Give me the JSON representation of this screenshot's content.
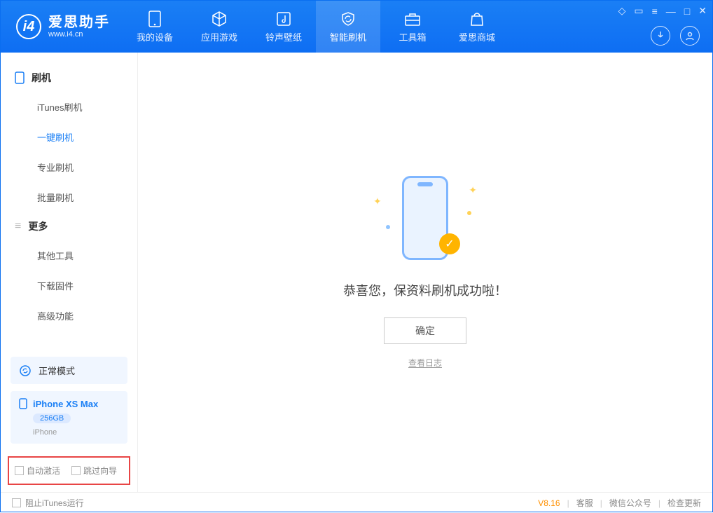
{
  "app": {
    "name": "爱思助手",
    "site": "www.i4.cn"
  },
  "nav": {
    "tabs": [
      "我的设备",
      "应用游戏",
      "铃声壁纸",
      "智能刷机",
      "工具箱",
      "爱思商城"
    ],
    "active_index": 3
  },
  "sidebar": {
    "section1": {
      "title": "刷机",
      "items": [
        "iTunes刷机",
        "一键刷机",
        "专业刷机",
        "批量刷机"
      ],
      "active_index": 1
    },
    "section2": {
      "title": "更多",
      "items": [
        "其他工具",
        "下载固件",
        "高级功能"
      ]
    },
    "status": "正常模式",
    "device": {
      "name": "iPhone XS Max",
      "capacity": "256GB",
      "type": "iPhone"
    },
    "options": {
      "auto_activate": "自动激活",
      "skip_guide": "跳过向导"
    }
  },
  "main": {
    "success_text": "恭喜您，保资料刷机成功啦！",
    "ok_button": "确定",
    "view_log": "查看日志"
  },
  "footer": {
    "block_itunes": "阻止iTunes运行",
    "version": "V8.16",
    "links": [
      "客服",
      "微信公众号",
      "检查更新"
    ]
  }
}
